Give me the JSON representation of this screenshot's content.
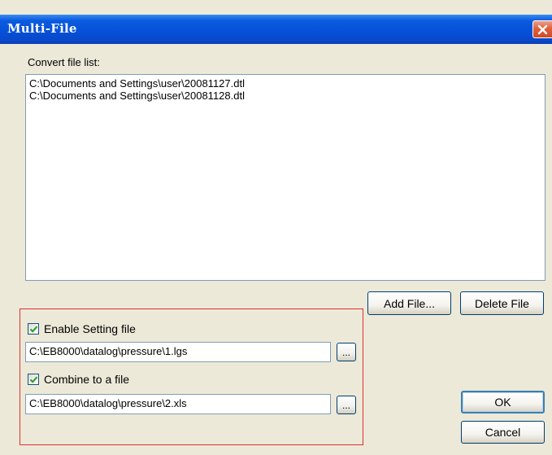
{
  "window": {
    "title": "Multi-File",
    "close_icon": "close-x-icon",
    "accent_color": "#0550D8",
    "close_color": "#D04A28"
  },
  "convert": {
    "label": "Convert file list:",
    "files": [
      "C:\\Documents and Settings\\user\\20081127.dtl",
      "C:\\Documents and Settings\\user\\20081128.dtl"
    ],
    "add_file_label": "Add File...",
    "delete_file_label": "Delete File"
  },
  "setting": {
    "enable_label": "Enable Setting file",
    "enable_checked": true,
    "path": "C:\\EB8000\\datalog\\pressure\\1.lgs",
    "browse_label": "..."
  },
  "combine": {
    "label": "Combine to a file",
    "checked": true,
    "path": "C:\\EB8000\\datalog\\pressure\\2.xls",
    "browse_label": "..."
  },
  "actions": {
    "ok_label": "OK",
    "cancel_label": "Cancel"
  }
}
